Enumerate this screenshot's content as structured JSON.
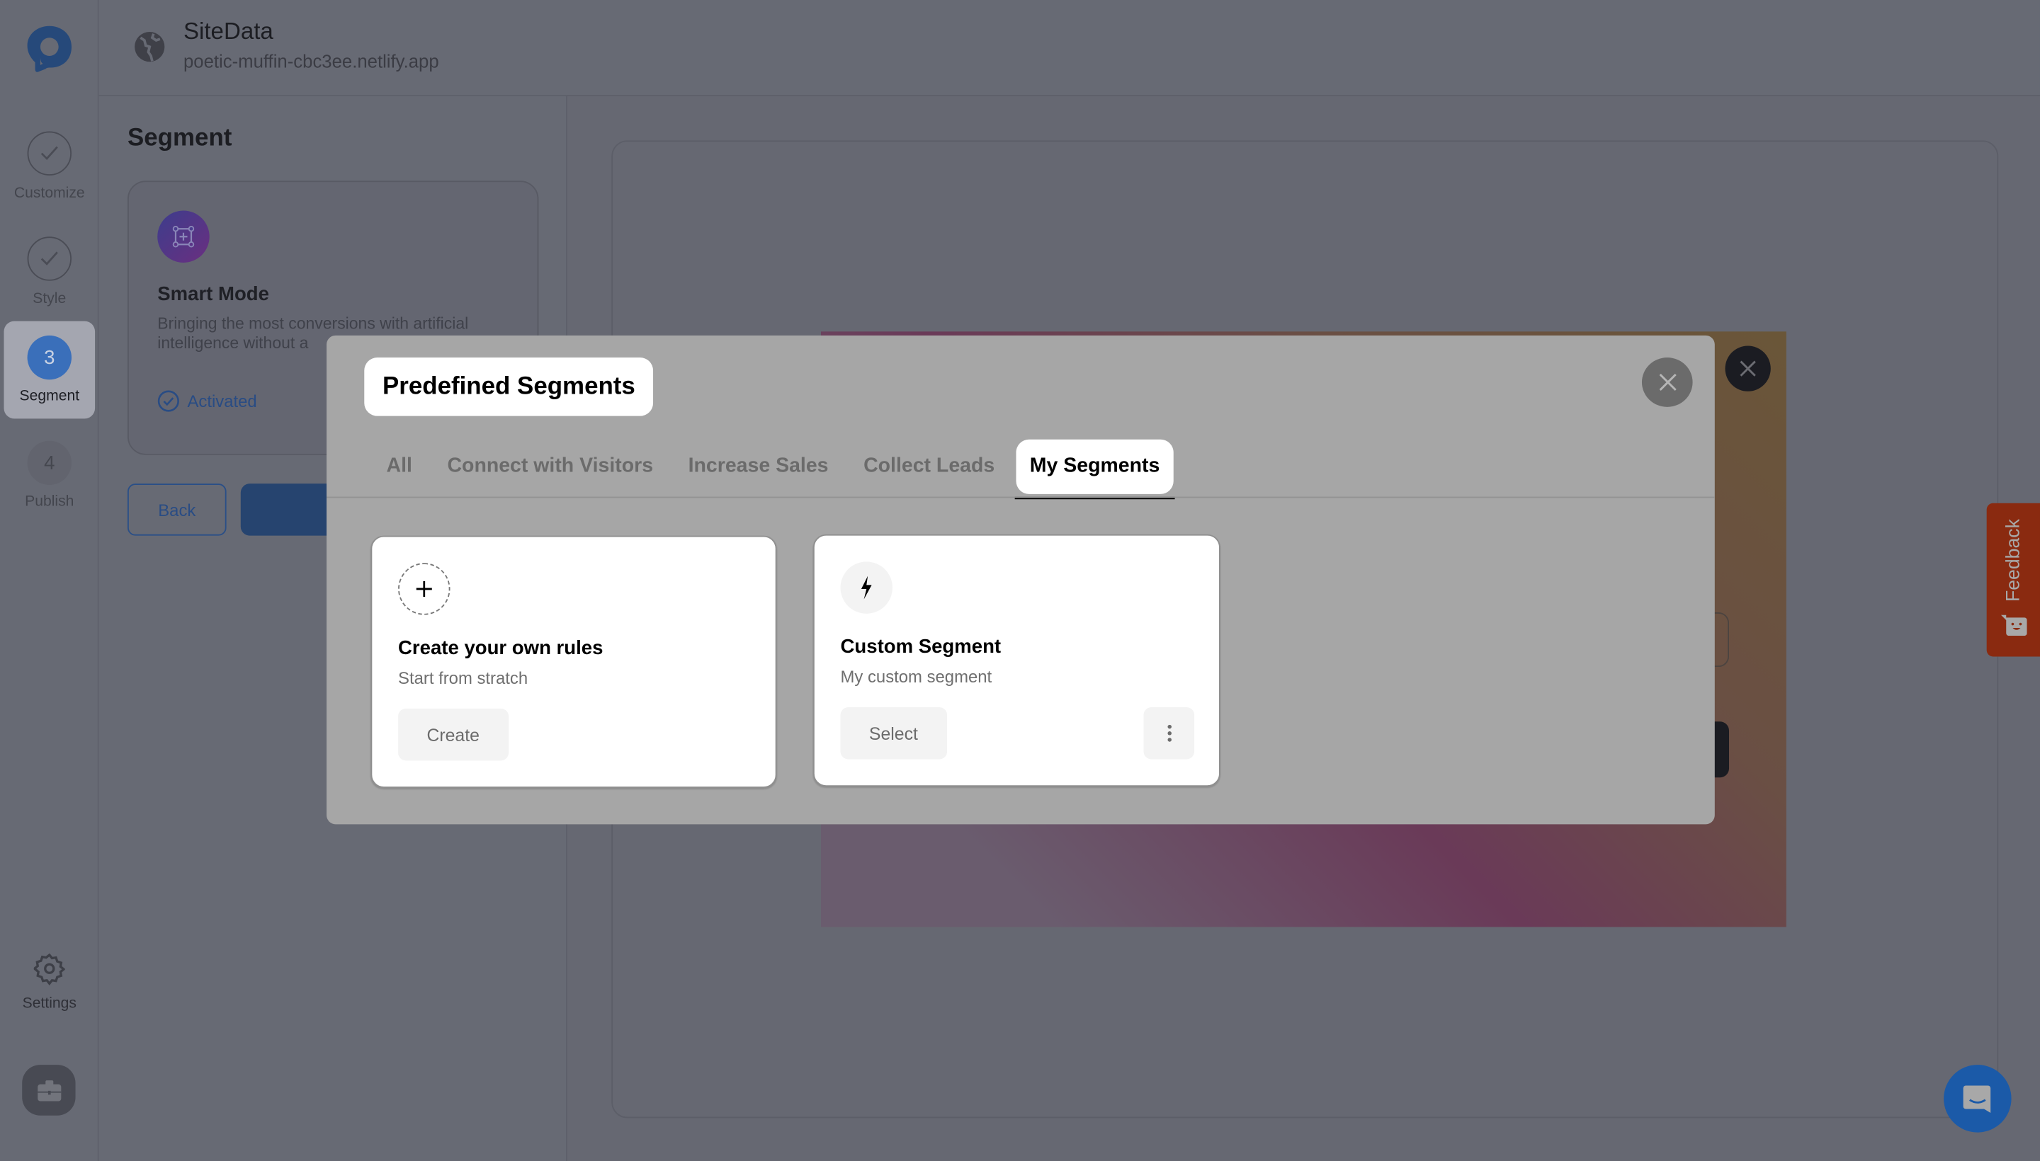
{
  "app": {
    "site_title": "SiteData",
    "site_url": "poetic-muffin-cbc3ee.netlify.app"
  },
  "steps": [
    {
      "label": "Customize",
      "state": "done",
      "number": ""
    },
    {
      "label": "Style",
      "state": "done",
      "number": ""
    },
    {
      "label": "Segment",
      "state": "active",
      "number": "3"
    },
    {
      "label": "Publish",
      "state": "future",
      "number": "4"
    }
  ],
  "rail": {
    "settings_label": "Settings"
  },
  "segment_panel": {
    "title": "Segment",
    "smart_mode": {
      "name": "Smart Mode",
      "description": "Bringing the most conversions with artificial intelligence without a",
      "status": "Activated"
    },
    "back_label": "Back",
    "next_label": ""
  },
  "feedback": {
    "label": "Feedback"
  },
  "modal": {
    "title": "Predefined Segments",
    "tabs": [
      {
        "label": "All",
        "active": false
      },
      {
        "label": "Connect with Visitors",
        "active": false
      },
      {
        "label": "Increase Sales",
        "active": false
      },
      {
        "label": "Collect Leads",
        "active": false
      },
      {
        "label": "My Segments",
        "active": true
      }
    ],
    "cards": [
      {
        "icon": "plus-icon",
        "title": "Create your own rules",
        "subtitle": "Start from stratch",
        "button": "Create"
      },
      {
        "icon": "lightning-icon",
        "title": "Custom Segment",
        "subtitle": "My custom segment",
        "button": "Select"
      }
    ]
  },
  "colors": {
    "accent": "#3a6fba",
    "feedback": "#8a2a10",
    "chat": "#1b5aa8"
  }
}
